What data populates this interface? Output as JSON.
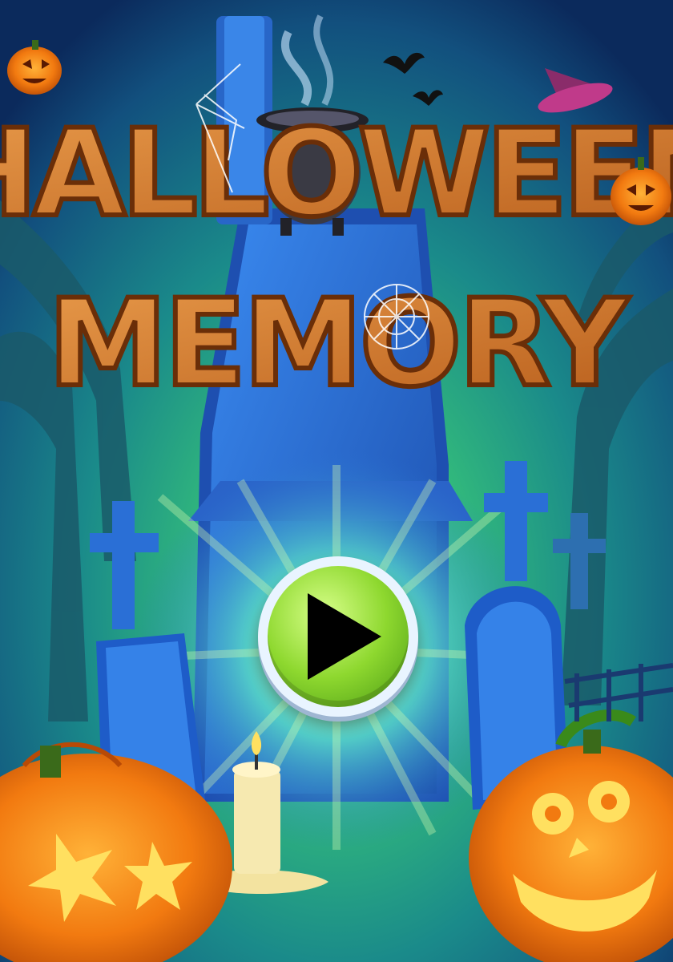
{
  "game": {
    "title_line1": "HALLOWEEN",
    "title_line2": "MEMORY",
    "play_button_label": "Play",
    "play_icon": "play-icon"
  },
  "colors": {
    "sky_top": "#0b2a5c",
    "sky_mid": "#1f6f8f",
    "glow_green": "#5fe07a",
    "wood": "#d07a2e",
    "wood_dark": "#8a4416",
    "tomb_blue": "#2a6fd6",
    "button_green": "#7ed12b",
    "pumpkin": "#f27a10"
  }
}
